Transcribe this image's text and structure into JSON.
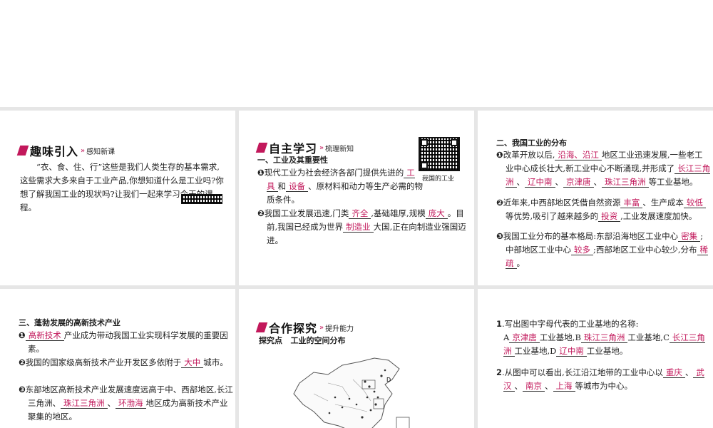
{
  "p1": {
    "title": "趣味引入",
    "subtitle": "感知新课",
    "text": "“衣、食、住、行”这些是我们人类生存的基本需求,这些需求大多来自于工业产品,你想知道什么是工业吗?你想了解我国工业的现状吗?让我们一起来学习今天的课程。"
  },
  "p2": {
    "title": "自主学习",
    "subtitle": "梳理新知",
    "section1": "一、工业及其重要性",
    "qr_caption": "我国的工业",
    "item1_num": "❶",
    "item1_a": "现代工业为社会经济各部门提供先进的",
    "item1_ans1": "工具",
    "item1_b": "和",
    "item1_ans2": "设备",
    "item1_c": "、原材料和动力等生产必需的物质条件。",
    "item2_num": "❷",
    "item2_a": "我国工业发展迅速,门类",
    "item2_ans1": "齐全",
    "item2_b": ",基础雄厚,规模",
    "item2_ans2": "庞大",
    "item2_c": "。目前,我国已经成为世界",
    "item2_ans3": "制造业",
    "item2_d": "大国,正在向制造业强国迈进。"
  },
  "p3": {
    "section2": "二、我国工业的分布",
    "item1_num": "❶",
    "item1_a": "改革开放以后,",
    "item1_ans1": "沿海、沿江",
    "item1_b": "地区工业迅速发展,一些老工业中心成长壮大,新工业中心不断涌现,并形成了",
    "item1_ans2": "长江三角洲",
    "item1_c": "、",
    "item1_ans3": "辽中南",
    "item1_d": "、",
    "item1_ans4": "京津唐",
    "item1_e": "、",
    "item1_ans5": "珠江三角洲",
    "item1_f": "等工业基地。",
    "item2_num": "❷",
    "item2_a": "近年来,中西部地区凭借自然资源",
    "item2_ans1": "丰富",
    "item2_b": "、生产成本",
    "item2_ans2": "较低",
    "item2_c": "等优势,吸引了越来越多的",
    "item2_ans3": "投资",
    "item2_d": ",工业发展速度加快。",
    "item3_num": "❸",
    "item3_a": "我国工业分布的基本格局:东部沿海地区工业中心",
    "item3_ans1": "密集",
    "item3_b": ";中部地区工业中心",
    "item3_ans2": "较多",
    "item3_c": ";西部地区工业中心较少,分布",
    "item3_ans3": "稀疏",
    "item3_d": "。"
  },
  "p4": {
    "section3": "三、蓬勃发展的高新技术产业",
    "item1_num": "❶",
    "item1_ans": "高新技术",
    "item1_a": "产业成为带动我国工业实现科学发展的重要因素。",
    "item2_num": "❷",
    "item2_a": "我国的国家级高新技术产业开发区多依附于",
    "item2_ans": "大中",
    "item2_b": "城市。",
    "item3_num": "❸",
    "item3_a": "东部地区高新技术产业发展速度远高于中、西部地区,长江三角洲、",
    "item3_ans1": "珠江三角洲",
    "item3_b": "、",
    "item3_ans2": "环渤海",
    "item3_c": "地区成为高新技术产业聚集的地区。"
  },
  "p5": {
    "title": "合作探究",
    "subtitle": "提升能力",
    "point_label": "探究点",
    "point_title": "工业的空间分布",
    "map_letter": "D"
  },
  "p6": {
    "q1_num": "1",
    "q1_a": "写出图中字母代表的工业基地的名称:",
    "q1_A": "A",
    "q1_ansA": "京津唐",
    "q1_b": "工业基地,B",
    "q1_ansB": "珠江三角洲",
    "q1_c": "工业基地,C",
    "q1_ansC": "长江三角洲",
    "q1_d": "工业基地,D",
    "q1_ansD": "辽中南",
    "q1_e": "工业基地。",
    "q2_num": "2",
    "q2_a": "从图中可以看出,长江沿江地带的工业中心以",
    "q2_ans1": "重庆",
    "q2_sep1": "、",
    "q2_ans2": "武汉",
    "q2_sep2": "、",
    "q2_ans3": "南京",
    "q2_sep3": "、",
    "q2_ans4": "上海",
    "q2_b": "等城市为中心。"
  },
  "colors": {
    "accent": "#c2185b",
    "answer": "#c2185b",
    "background": "#e6e6e6"
  },
  "icons": [
    "title-marker-icon",
    "double-arrow-icon",
    "qr-code-icon",
    "china-map-image"
  ]
}
